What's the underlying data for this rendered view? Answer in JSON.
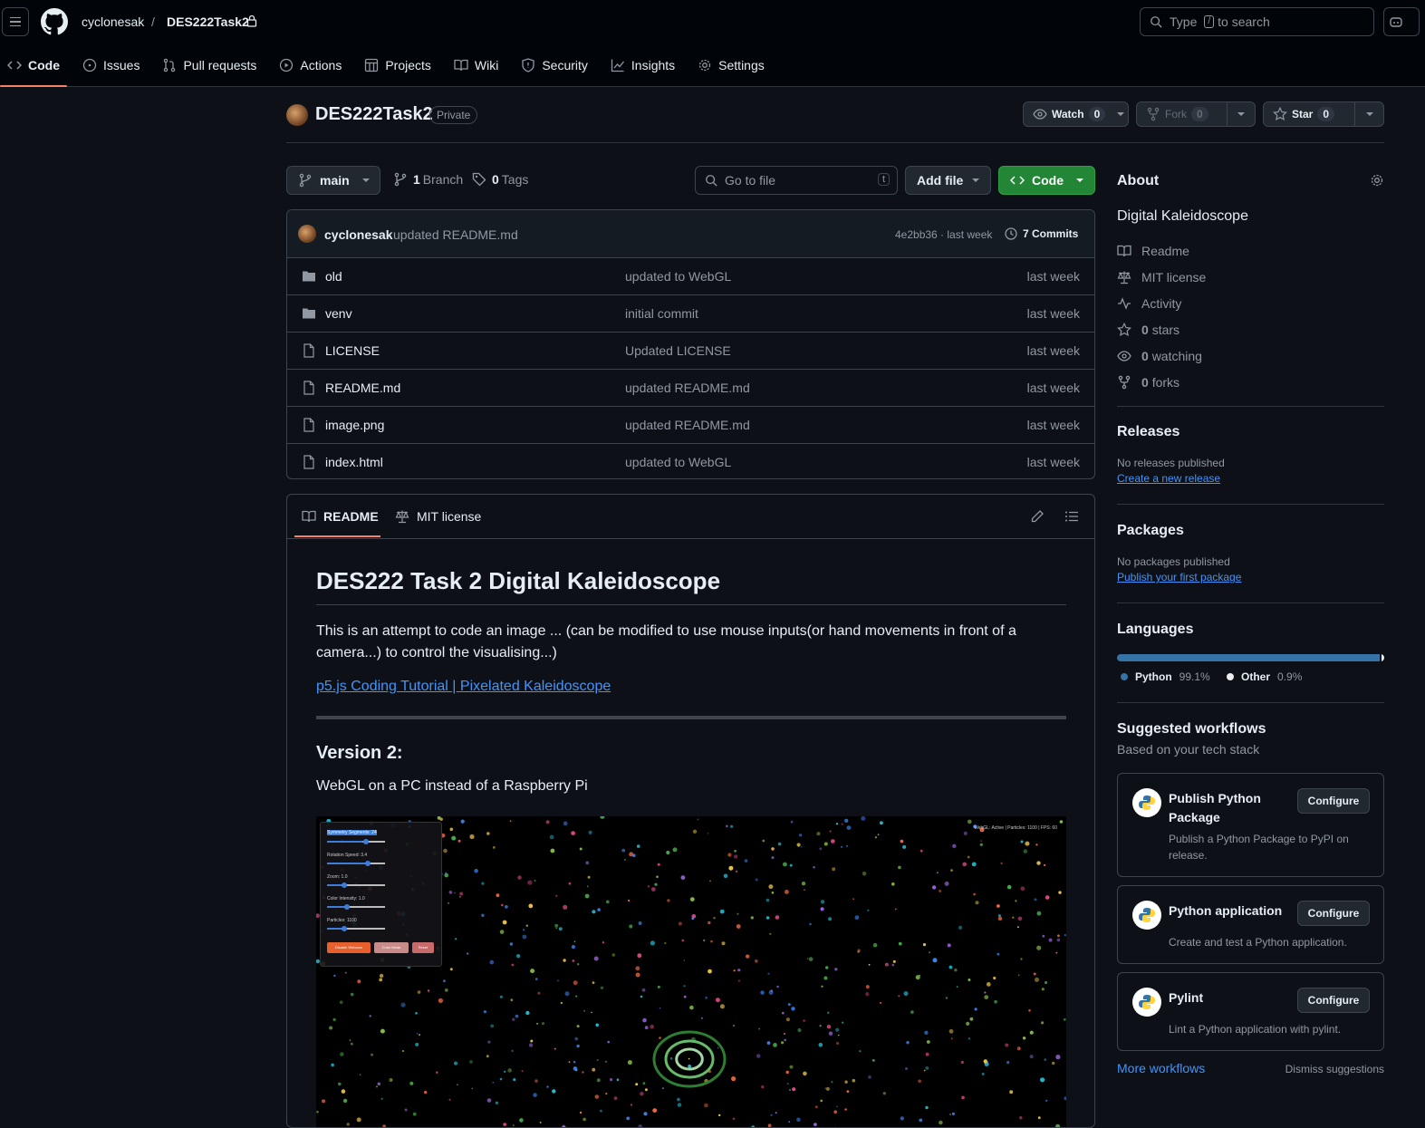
{
  "header": {
    "owner": "cyclonesak",
    "separator": "/",
    "repo": "DES222Task2",
    "search_prefix": "Type",
    "search_key": "/",
    "search_suffix": "to search"
  },
  "nav": [
    {
      "label": "Code",
      "icon": "code-icon"
    },
    {
      "label": "Issues",
      "icon": "issue-icon"
    },
    {
      "label": "Pull requests",
      "icon": "pull-request-icon"
    },
    {
      "label": "Actions",
      "icon": "play-icon"
    },
    {
      "label": "Projects",
      "icon": "table-icon"
    },
    {
      "label": "Wiki",
      "icon": "book-icon"
    },
    {
      "label": "Security",
      "icon": "shield-icon"
    },
    {
      "label": "Insights",
      "icon": "graph-icon"
    },
    {
      "label": "Settings",
      "icon": "gear-icon"
    }
  ],
  "repo": {
    "title": "DES222Task2",
    "visibility": "Private",
    "watch_label": "Watch",
    "watch_count": "0",
    "fork_label": "Fork",
    "fork_count": "0",
    "star_label": "Star",
    "star_count": "0"
  },
  "toolbar": {
    "branch": "main",
    "branch_count": "1",
    "branch_word": "Branch",
    "tag_count": "0",
    "tag_word": "Tags",
    "goto_placeholder": "Go to file",
    "goto_key": "t",
    "add_file": "Add file",
    "code": "Code"
  },
  "commit": {
    "user": "cyclonesak",
    "message": "updated README.md",
    "meta": "4e2bb36 · last week",
    "count": "7 Commits"
  },
  "files": [
    {
      "name": "old",
      "type": "folder",
      "commit": "updated to WebGL",
      "date": "last week"
    },
    {
      "name": "venv",
      "type": "folder",
      "commit": "initial commit",
      "date": "last week"
    },
    {
      "name": "LICENSE",
      "type": "file",
      "commit": "Updated LICENSE",
      "date": "last week"
    },
    {
      "name": "README.md",
      "type": "file",
      "commit": "updated README.md",
      "date": "last week"
    },
    {
      "name": "image.png",
      "type": "file",
      "commit": "updated README.md",
      "date": "last week"
    },
    {
      "name": "index.html",
      "type": "file",
      "commit": "updated to WebGL",
      "date": "last week"
    }
  ],
  "readme": {
    "tab_readme": "README",
    "tab_license": "MIT license",
    "h1": "DES222 Task 2 Digital Kaleidoscope",
    "p1": "This is an attempt to code an image ... (can be modified to use mouse inputs(or hand movements in front of a camera...) to control the visualising...)",
    "link": "p5.js Coding Tutorial | Pixelated Kaleidoscope",
    "h2": "Version 2:",
    "p2": "WebGL on a PC instead of a Raspberry Pi",
    "image": {
      "labels": [
        "Symmetry Segments: 24",
        "Rotation Speed: 3.4",
        "Zoom: 1.0",
        "Color Intensity: 1.0",
        "Particles: 1100"
      ],
      "slider_levels": [
        0.62,
        0.66,
        0.25,
        0.3,
        0.25
      ],
      "buttons": [
        "Disable Webcam",
        "Color Mode",
        "Reset"
      ],
      "hud": "WebGL: Active | Particles: 1100 | FPS: 60"
    }
  },
  "about": {
    "title": "About",
    "description": "Digital Kaleidoscope",
    "readme": "Readme",
    "license": "MIT license",
    "activity": "Activity",
    "stars_count": "0",
    "stars_word": "stars",
    "watching_count": "0",
    "watching_word": "watching",
    "forks_count": "0",
    "forks_word": "forks"
  },
  "releases": {
    "title": "Releases",
    "empty": "No releases published",
    "link": "Create a new release"
  },
  "packages": {
    "title": "Packages",
    "empty": "No packages published",
    "link": "Publish your first package"
  },
  "languages": {
    "title": "Languages",
    "items": [
      {
        "name": "Python",
        "percent": "99.1%",
        "value": 99.1,
        "color": "#3572A5"
      },
      {
        "name": "Other",
        "percent": "0.9%",
        "value": 0.9,
        "color": "#ededed"
      }
    ]
  },
  "workflows": {
    "title": "Suggested workflows",
    "subtitle": "Based on your tech stack",
    "configure": "Configure",
    "items": [
      {
        "title": "Publish Python Package",
        "desc": "Publish a Python Package to PyPI on release."
      },
      {
        "title": "Python application",
        "desc": "Create and test a Python application."
      },
      {
        "title": "Pylint",
        "desc": "Lint a Python application with pylint."
      }
    ],
    "more": "More workflows",
    "dismiss": "Dismiss suggestions"
  }
}
